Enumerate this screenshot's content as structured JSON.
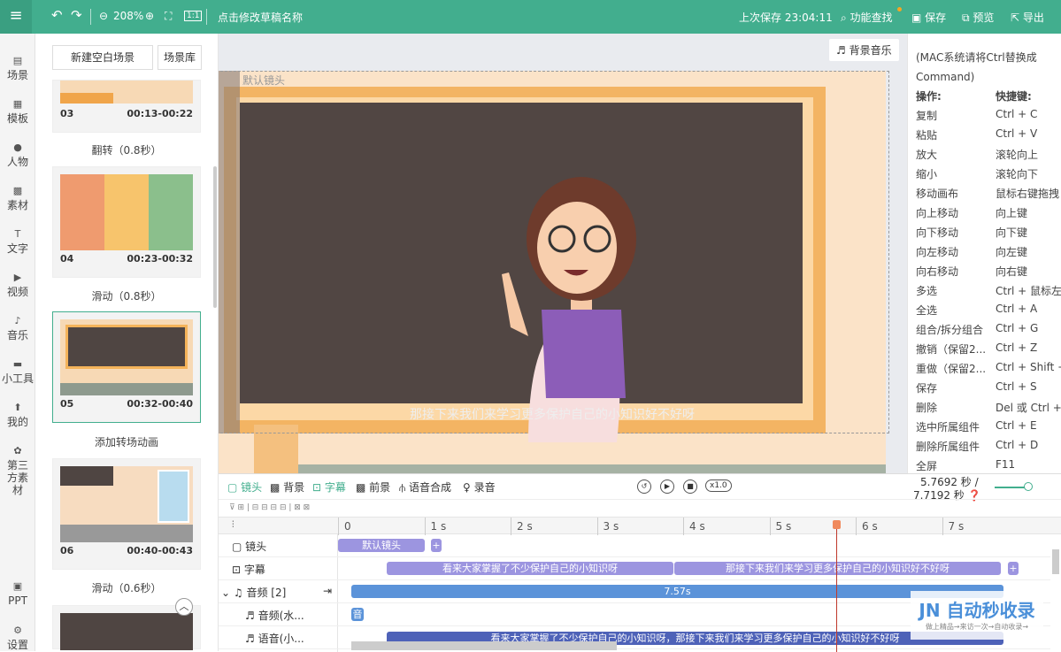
{
  "topbar": {
    "zoom": "208%",
    "draft_name": "点击修改草稿名称",
    "last_saved": "上次保存 23:04:11",
    "features": "功能查找",
    "save": "保存",
    "preview": "预览",
    "export": "导出"
  },
  "sidebar": [
    "场景",
    "模板",
    "人物",
    "素材",
    "文字",
    "视频",
    "音乐",
    "小工具",
    "我的",
    "第三方素材",
    "PPT",
    "设置"
  ],
  "scenes": {
    "new_blank": "新建空白场景",
    "library": "场景库",
    "cards": [
      {
        "num": "03",
        "time": "00:13-00:22",
        "transition": "翻转（0.8秒）"
      },
      {
        "num": "04",
        "time": "00:23-00:32",
        "transition": "滑动（0.8秒）"
      },
      {
        "num": "05",
        "time": "00:32-00:40",
        "transition": "添加转场动画"
      },
      {
        "num": "06",
        "time": "00:40-00:43",
        "transition": "滑动（0.6秒）"
      }
    ]
  },
  "canvas": {
    "bgm_button": "背景音乐",
    "camera_label": "默认镜头",
    "subtitle": "那接下来我们来学习更多保护自己的小知识好不好呀"
  },
  "shortcuts": {
    "note": "(MAC系统请将Ctrl替换成Command)",
    "head_op": "操作:",
    "head_key": "快捷键:",
    "items": [
      [
        "复制",
        "Ctrl + C"
      ],
      [
        "粘贴",
        "Ctrl + V"
      ],
      [
        "放大",
        "滚轮向上"
      ],
      [
        "缩小",
        "滚轮向下"
      ],
      [
        "移动画布",
        "鼠标右键拖拽"
      ],
      [
        "向上移动",
        "向上键"
      ],
      [
        "向下移动",
        "向下键"
      ],
      [
        "向左移动",
        "向左键"
      ],
      [
        "向右移动",
        "向右键"
      ],
      [
        "多选",
        "Ctrl + 鼠标左键"
      ],
      [
        "全选",
        "Ctrl + A"
      ],
      [
        "组合/拆分组合",
        "Ctrl + G"
      ],
      [
        "撤销（保留2...",
        "Ctrl + Z"
      ],
      [
        "重做（保留2...",
        "Ctrl + Shift + Z"
      ],
      [
        "保存",
        "Ctrl + S"
      ],
      [
        "删除",
        "Del 或 Ctrl + D"
      ],
      [
        "选中所属组件",
        "Ctrl + E"
      ],
      [
        "删除所属组件",
        "Ctrl + D"
      ],
      [
        "全屏",
        "F11"
      ]
    ]
  },
  "timeline": {
    "tabs": [
      "镜头",
      "背景",
      "字幕",
      "前景",
      "语音合成",
      "录音"
    ],
    "speed": "x1.0",
    "current_time": "5.7692 秒 /",
    "total_time": "7.7192 秒",
    "ticks": [
      "0",
      "1 s",
      "2 s",
      "3 s",
      "4 s",
      "5 s",
      "6 s",
      "7 s"
    ],
    "playhead_seconds": 5.77,
    "rows": {
      "camera": "镜头",
      "subtitle": "字幕",
      "audio": "音频 [2]",
      "audio_water": "音频(水...",
      "voice": "语音(小..."
    },
    "camera_clip": "默认镜头",
    "subtitle_clips": [
      "看来大家掌握了不少保护自己的小知识呀",
      "那接下来我们来学习更多保护自己的小知识好不好呀"
    ],
    "audio_clip": "7.57s",
    "audio_water_clip": "音",
    "voice_clip": "看来大家掌握了不少保护自己的小知识呀，那接下来我们来学习更多保护自己的小知识好不好呀"
  },
  "watermark": {
    "brand": "自动秒收录",
    "slogan": "做上精品→来访一次→自动收录→"
  },
  "colors": {
    "primary": "#42ae8e",
    "clip": "#9c95e0",
    "audio": "#5b93d9",
    "playhead": "#e05a3a"
  }
}
